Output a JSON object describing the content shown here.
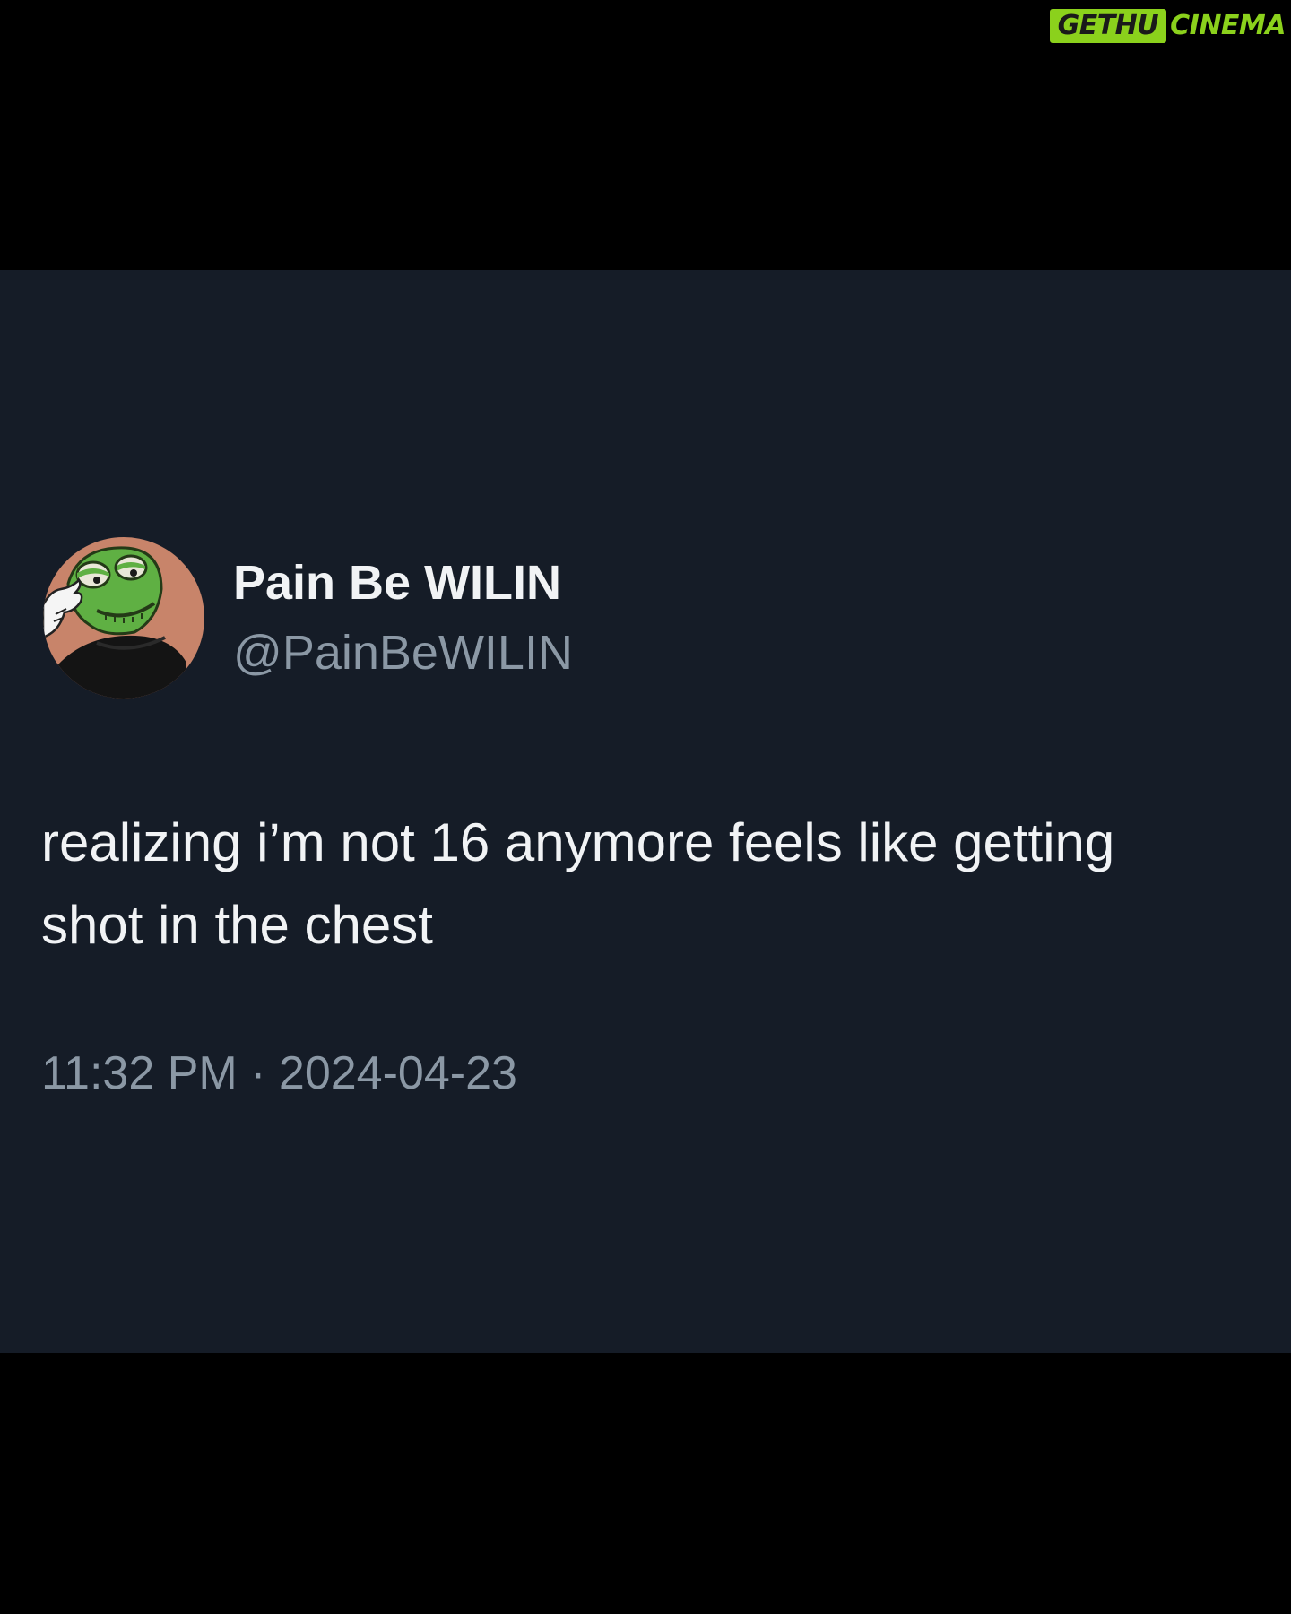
{
  "watermark": {
    "part1": "GETHU",
    "part2": "CINEMA",
    "color": "#8bd11c"
  },
  "tweet": {
    "display_name": "Pain Be WILIN",
    "handle": "@PainBeWILIN",
    "text": "realizing i’m not 16 anymore feels like getting shot in the chest",
    "timestamp": "11:32 PM · 2024-04-23",
    "avatar_icon": "frog-avatar-icon",
    "background": "#151c27"
  }
}
